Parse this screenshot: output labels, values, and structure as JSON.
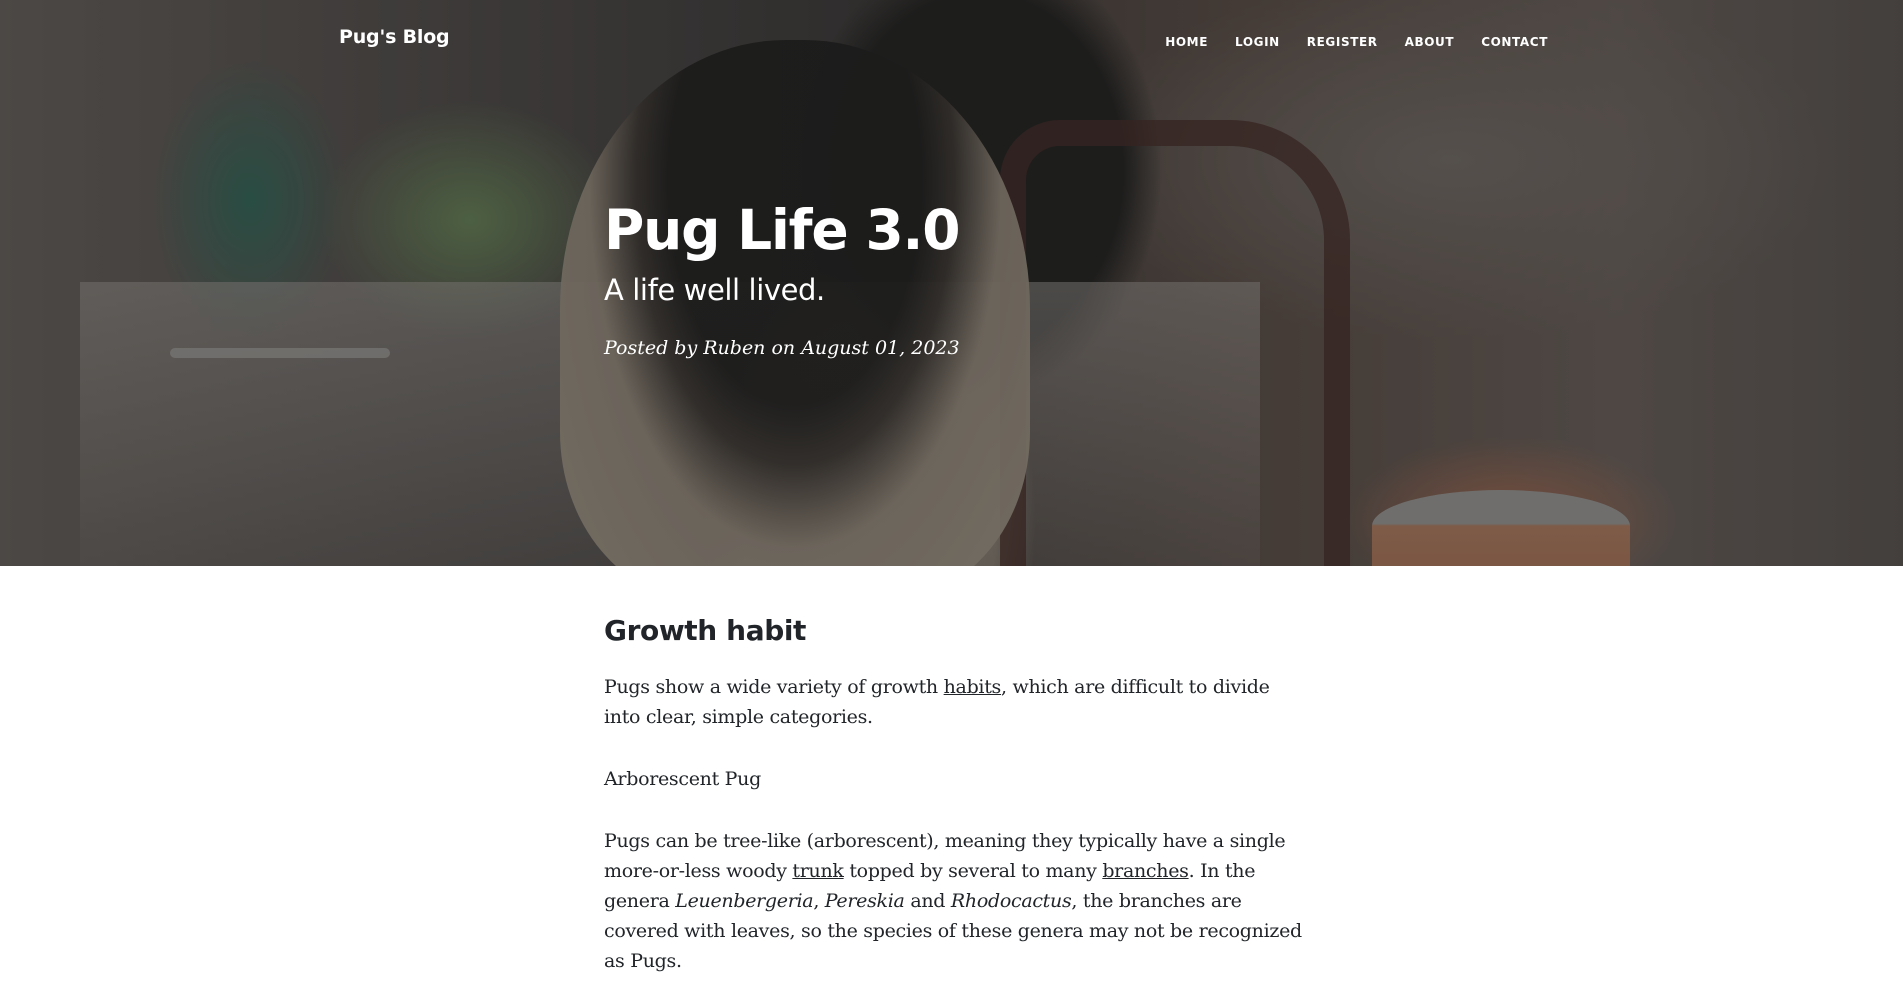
{
  "nav": {
    "brand": "Pug's Blog",
    "links": [
      "HOME",
      "LOGIN",
      "REGISTER",
      "ABOUT",
      "CONTACT"
    ]
  },
  "hero": {
    "title": "Pug Life 3.0",
    "subtitle": "A life well lived.",
    "meta_prefix": "Posted by ",
    "author": "Ruben",
    "meta_middle": " on ",
    "date": "August 01, 2023"
  },
  "article": {
    "heading": "Growth habit",
    "p1": {
      "before": "Pugs show a wide variety of growth ",
      "link": "habits",
      "after": ", which are difficult to divide into clear, simple categories."
    },
    "p2": "Arborescent Pug",
    "p3": {
      "t1": "Pugs can be tree-like (arborescent), meaning they typically have a single more-or-less woody ",
      "link1": "trunk",
      "t2": " topped by several to many ",
      "link2": "branches",
      "t3": ". In the genera ",
      "i1": "Leuenbergeria",
      "t4": ", ",
      "i2": "Pereskia",
      "t5": " and ",
      "i3": "Rhodocactus",
      "t6": ", the branches are covered with leaves, so the species of these genera may not be recognized as Pugs."
    }
  },
  "colors": {
    "overlay": "#212529",
    "text_dark": "#212529",
    "text_light": "#ffffff"
  }
}
